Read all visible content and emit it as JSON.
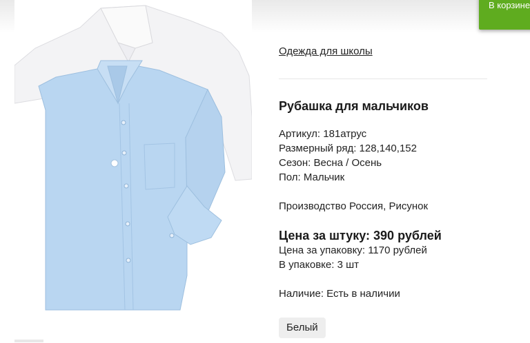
{
  "cart": {
    "label": "В корзине"
  },
  "product": {
    "category": "Одежда для школы",
    "title": "Рубашка для мальчиков",
    "article": "Артикул: 181атрус",
    "sizes": "Размерный ряд: 128,140,152",
    "season": "Сезон: Весна / Осень",
    "gender": "Пол: Мальчик",
    "production": "Производство Россия, Рисунок",
    "price_unit": "Цена за штуку: 390 рублей",
    "price_pack": "Цена за упаковку: 1170 рублей",
    "pack_qty": "В упаковке: 3 шт",
    "availability": "Наличие: Есть в наличии",
    "color_option": "Белый"
  },
  "colors": {
    "accent": "#5fac1f",
    "shirt_blue": "#b9d6f1",
    "shirt_white": "#f4f4f6"
  }
}
